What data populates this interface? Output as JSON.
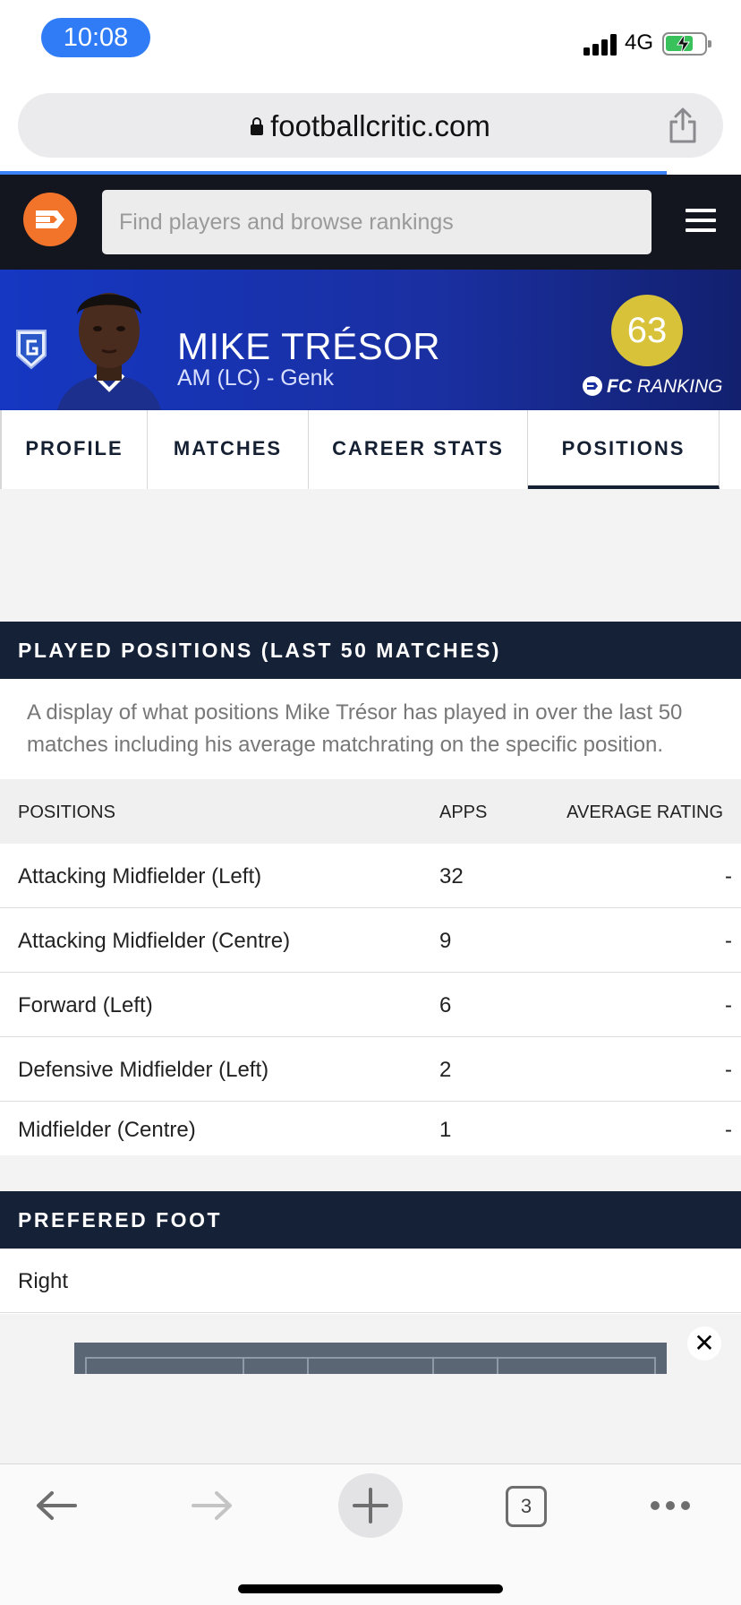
{
  "status_bar": {
    "time": "10:08",
    "network": "4G"
  },
  "browser": {
    "url": "footballcritic.com",
    "open_tabs": "3"
  },
  "site": {
    "search_placeholder": "Find players and browse rankings"
  },
  "player": {
    "name": "MIKE TRÉSOR",
    "subtitle": "AM (LC) - Genk",
    "ranking": "63",
    "ranking_label_bold": "FC",
    "ranking_label": " RANKING"
  },
  "tabs": [
    {
      "label": "PROFILE"
    },
    {
      "label": "MATCHES"
    },
    {
      "label": "CAREER STATS"
    },
    {
      "label": "POSITIONS",
      "active": true
    }
  ],
  "positions_section": {
    "title": "PLAYED POSITIONS (LAST 50 MATCHES)",
    "description": "A display of what positions Mike Trésor has played in over the last 50 matches including his average matchrating on the specific position.",
    "columns": [
      "POSITIONS",
      "APPS",
      "AVERAGE RATING"
    ],
    "rows": [
      {
        "position": "Attacking Midfielder (Left)",
        "apps": "32",
        "rating": "-"
      },
      {
        "position": "Attacking Midfielder (Centre)",
        "apps": "9",
        "rating": "-"
      },
      {
        "position": "Forward (Left)",
        "apps": "6",
        "rating": "-"
      },
      {
        "position": "Defensive Midfielder (Left)",
        "apps": "2",
        "rating": "-"
      },
      {
        "position": "Midfielder (Centre)",
        "apps": "1",
        "rating": "-"
      }
    ]
  },
  "foot_section": {
    "title": "PREFERED FOOT",
    "value": "Right"
  },
  "ad": {
    "close_label": "✕"
  },
  "colors": {
    "accent": "#2f7cf6",
    "header_dark": "#14161f",
    "section_navy": "#142136",
    "banner_blue": "#1537c2",
    "rank_gold": "#d8c23a",
    "logo_orange": "#f2732a"
  }
}
